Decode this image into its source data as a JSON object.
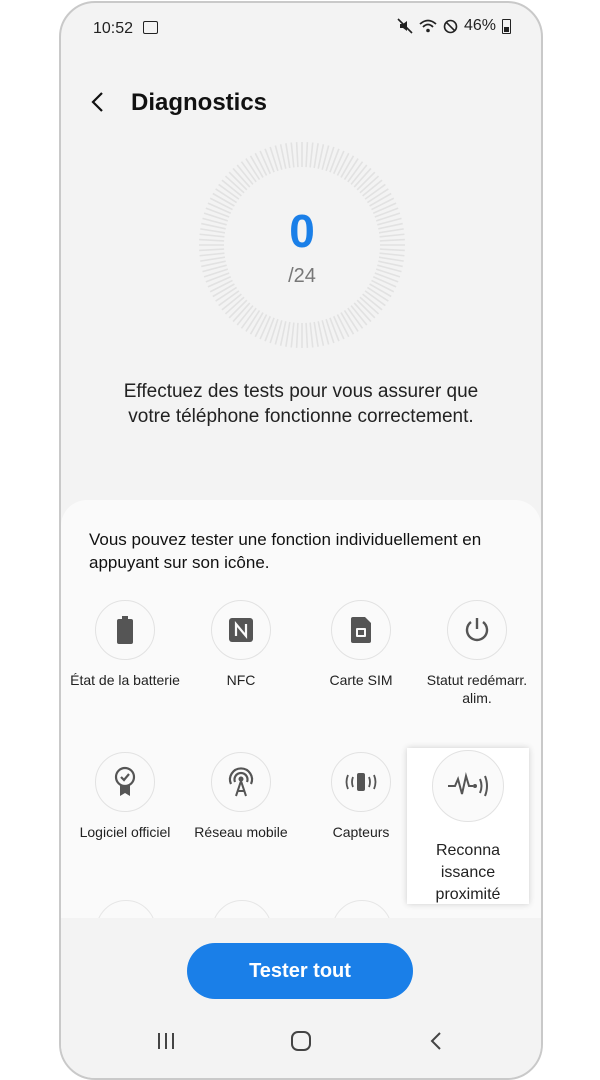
{
  "status_bar": {
    "time": "10:52",
    "battery": "46%"
  },
  "header": {
    "title": "Diagnostics"
  },
  "score": {
    "value": "0",
    "total": "/24"
  },
  "description": "Effectuez des tests pour vous assurer que votre téléphone fonctionne correctement.",
  "card": {
    "instruction": "Vous pouvez tester une fonction individuellement en appuyant sur son icône.",
    "tiles": [
      {
        "label": "État de la batterie",
        "icon": "battery-icon"
      },
      {
        "label": "NFC",
        "icon": "nfc-icon"
      },
      {
        "label": "Carte SIM",
        "icon": "sim-card-icon"
      },
      {
        "label": "Statut redémarr. alim.",
        "icon": "power-restart-icon"
      },
      {
        "label": "Logiciel officiel",
        "icon": "certificate-badge-icon"
      },
      {
        "label": "Réseau mobile",
        "icon": "cell-tower-icon"
      },
      {
        "label": "Capteurs",
        "icon": "sensor-vibration-icon"
      },
      {
        "label": "Reconna issance proximité",
        "icon": "proximity-wave-icon"
      }
    ]
  },
  "actions": {
    "test_all": "Tester tout"
  },
  "colors": {
    "accent": "#1a7fe8",
    "background": "#f3f3f3"
  }
}
